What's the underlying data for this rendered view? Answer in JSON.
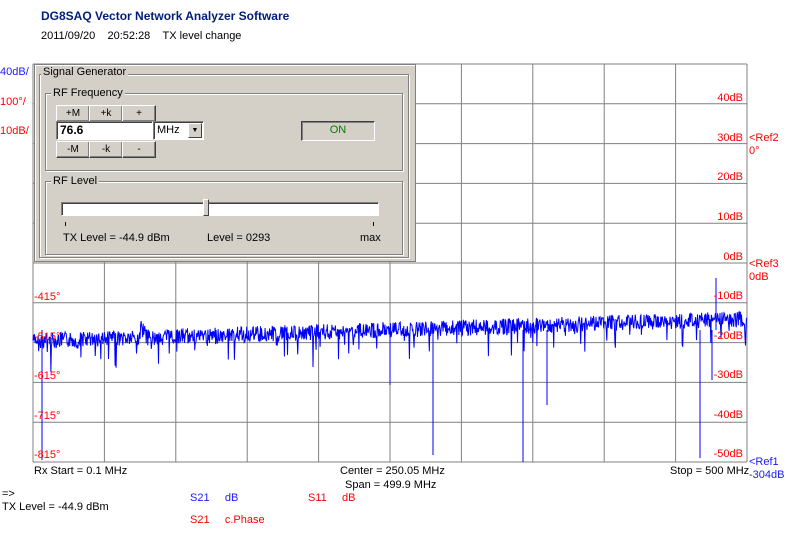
{
  "header": {
    "title": "DG8SAQ Vector Network Analyzer Software",
    "date": "2011/09/20",
    "time": "20:52:28",
    "note": "TX level change"
  },
  "left_axis_top": [
    "40dB/",
    "100°/",
    "10dB/"
  ],
  "phase_labels": [
    "-415°",
    "-515°",
    "-615°",
    "-715°",
    "-815°"
  ],
  "right_db_labels": [
    "40dB",
    "30dB",
    "20dB",
    "10dB",
    "0dB",
    "-10dB",
    "-20dB",
    "-30dB",
    "-40dB",
    "-50dB"
  ],
  "ref_markers": {
    "ref2": {
      "name": "<Ref2",
      "value": "0°"
    },
    "ref3": {
      "name": "<Ref3",
      "value": "0dB"
    },
    "ref1": {
      "name": "<Ref1",
      "value": "-304dB"
    }
  },
  "footer": {
    "rx_start": "Rx Start = 0.1 MHz",
    "center": "Center = 250.05 MHz",
    "span": "Span = 499.9 MHz",
    "stop": "Stop = 500 MHz",
    "arrow": "=>",
    "tx_level": "TX Level = -44.9 dBm"
  },
  "legend": {
    "s21_db": {
      "param": "S21",
      "unit": "dB"
    },
    "s11_db": {
      "param": "S11",
      "unit": "dB"
    },
    "s21_phase": {
      "param": "S21",
      "unit": "c.Phase"
    }
  },
  "signal_generator": {
    "title": "Signal Generator",
    "rf_frequency": {
      "title": "RF Frequency",
      "up_buttons": [
        "+M",
        "+k",
        "+"
      ],
      "down_buttons": [
        "-M",
        "-k",
        "-"
      ],
      "value": "76.6",
      "unit": "MHz",
      "on_label": "ON"
    },
    "rf_level": {
      "title": "RF Level",
      "tx_level": "TX Level = -44.9 dBm",
      "level": "Level = 0293",
      "max": "max",
      "slider_fraction": 0.45
    }
  },
  "colors": {
    "trace": "#0000ff",
    "phase_axis": "#ff0000",
    "db_axis": "#ff0000",
    "grid": "#808080"
  }
}
